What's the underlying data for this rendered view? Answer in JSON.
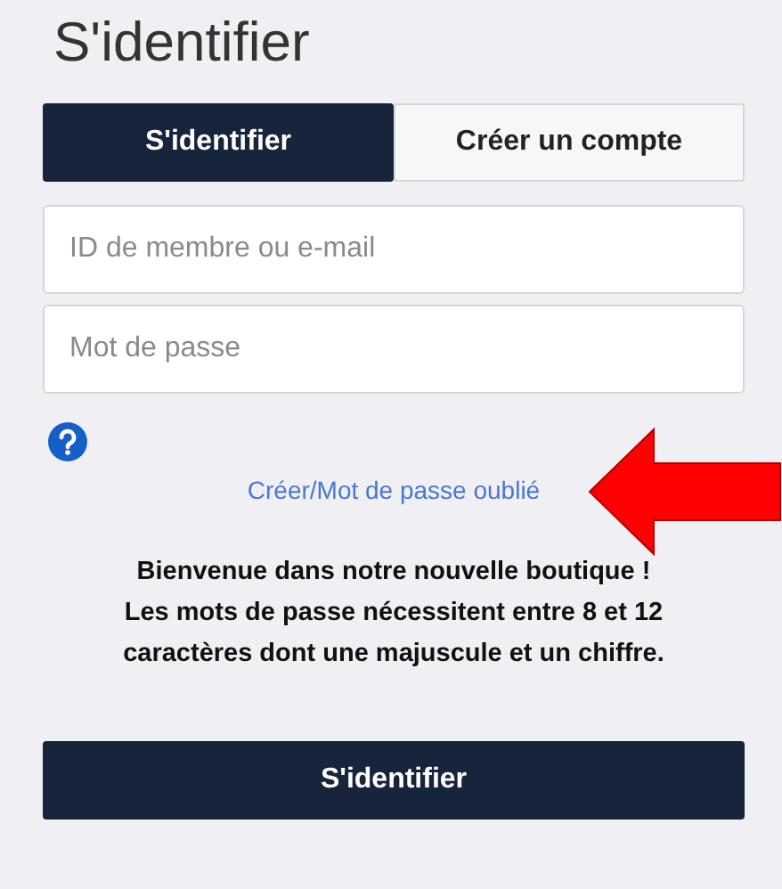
{
  "title": "S'identifier",
  "tabs": [
    {
      "label": "S'identifier",
      "selected": true
    },
    {
      "label": "Créer un compte",
      "selected": false
    }
  ],
  "fields": [
    {
      "placeholder": "ID de membre ou e-mail"
    },
    {
      "placeholder": "Mot de passe"
    }
  ],
  "help_link": "Créer/Mot de passe oublié",
  "message_lines": [
    "Bienvenue dans notre nouvelle boutique !",
    "Les mots de passe nécessitent entre 8 et 12",
    "caractères dont une majuscule et un chiffre."
  ],
  "submit_button": "S'identifier"
}
